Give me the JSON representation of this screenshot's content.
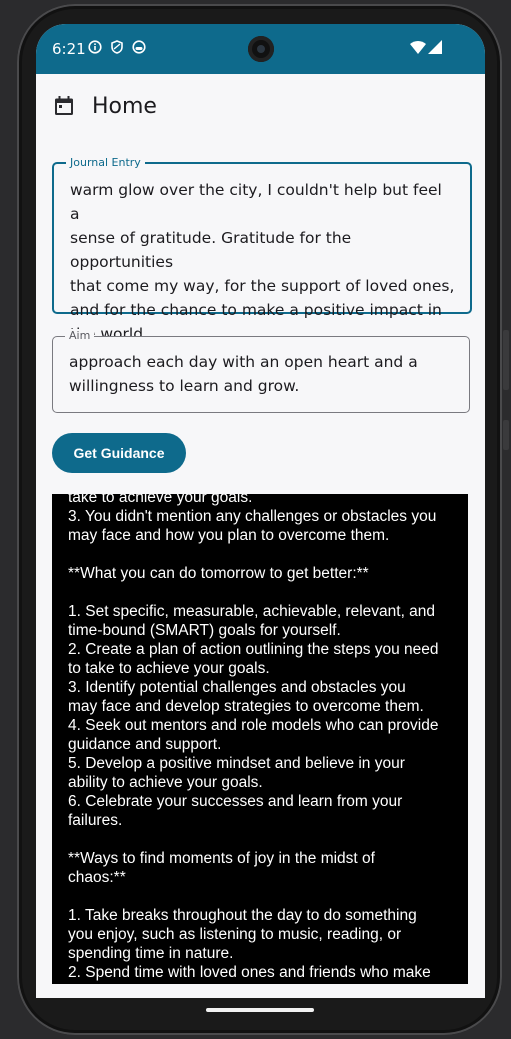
{
  "status_bar": {
    "time": "6:21",
    "background": "#0e6a8c"
  },
  "app_bar": {
    "title": "Home",
    "icon": "calendar-icon"
  },
  "journal": {
    "label": "Journal Entry",
    "value": "warm glow over the city, I couldn't help but feel a\nsense of gratitude. Gratitude for the opportunities\nthat come my way, for the support of loved ones,\nand for the chance to make a positive impact in\nthe world."
  },
  "aim": {
    "label": "Aim",
    "value": "approach each day with an open heart and a\nwillingness to learn and grow."
  },
  "button": {
    "label": "Get Guidance"
  },
  "guidance": {
    "text": "take to achieve your goals.\n3. You didn't mention any challenges or obstacles you\nmay face and how you plan to overcome them.\n\n**What you can do tomorrow to get better:**\n\n1. Set specific, measurable, achievable, relevant, and\ntime-bound (SMART) goals for yourself.\n2. Create a plan of action outlining the steps you need\nto take to achieve your goals.\n3. Identify potential challenges and obstacles you\nmay face and develop strategies to overcome them.\n4. Seek out mentors and role models who can provide\nguidance and support.\n5. Develop a positive mindset and believe in your\nability to achieve your goals.\n6. Celebrate your successes and learn from your\nfailures.\n\n**Ways to find moments of joy in the midst of\nchaos:**\n\n1. Take breaks throughout the day to do something\nyou enjoy, such as listening to music, reading, or\nspending time in nature.\n2. Spend time with loved ones and friends who make"
  }
}
